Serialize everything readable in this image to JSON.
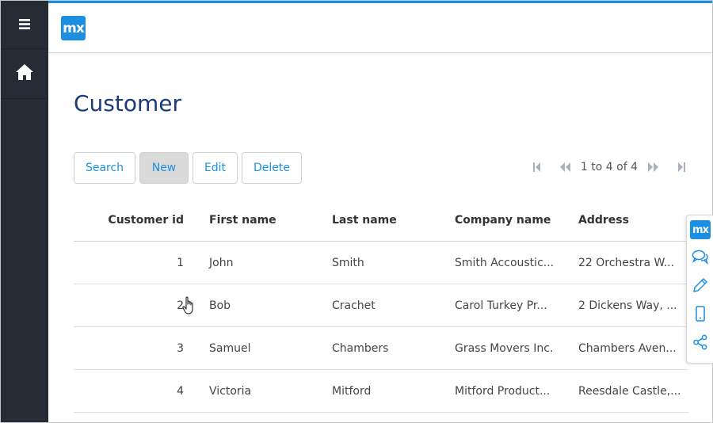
{
  "app": {
    "logo_text": "mx",
    "accent_color": "#1d8fe0",
    "sidebar_color": "#252c36",
    "title_color": "#1a3a78"
  },
  "sidebar": {
    "items": [
      {
        "icon": "menu-icon"
      },
      {
        "icon": "home-icon"
      }
    ]
  },
  "page": {
    "title": "Customer"
  },
  "toolbar": {
    "buttons": [
      "Search",
      "New",
      "Edit",
      "Delete"
    ]
  },
  "pager": {
    "text": "1 to 4 of 4"
  },
  "grid": {
    "columns": [
      "Customer id",
      "First name",
      "Last name",
      "Company name",
      "Address"
    ],
    "rows": [
      [
        "1",
        "John",
        "Smith",
        "Smith Accoustic...",
        "22 Orchestra W..."
      ],
      [
        "2",
        "Bob",
        "Crachet",
        "Carol Turkey Pr...",
        "2 Dickens Way, ..."
      ],
      [
        "3",
        "Samuel",
        "Chambers",
        "Grass Movers Inc.",
        "Chambers Aven..."
      ],
      [
        "4",
        "Victoria",
        "Mitford",
        "Mitford Product...",
        "Reesdale Castle,..."
      ]
    ]
  },
  "mx_panel": {
    "logo_text": "mx",
    "items": [
      "mx-logo-icon",
      "chat-icon",
      "pencil-icon",
      "mobile-phone-icon",
      "share-icon"
    ]
  }
}
